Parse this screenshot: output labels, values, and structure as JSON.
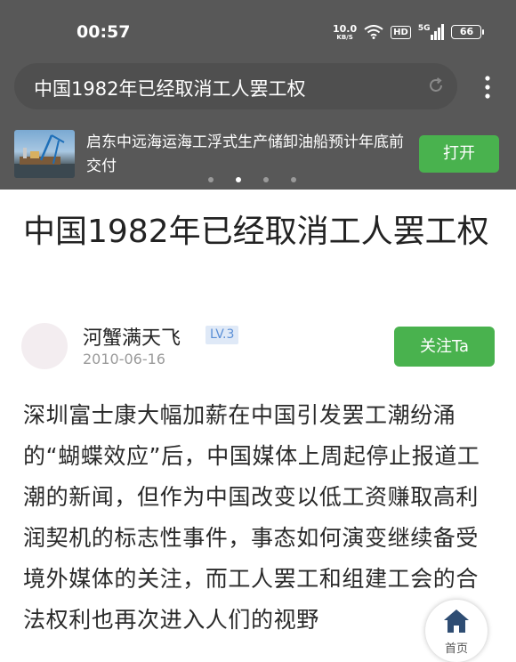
{
  "status_bar": {
    "time": "00:57",
    "net_speed_value": "10.0",
    "net_speed_unit": "KB/S",
    "hd": "HD",
    "signal": "5G",
    "battery": "66"
  },
  "search": {
    "query": "中国1982年已经取消工人罢工权",
    "refresh_icon": "refresh-icon",
    "more_icon": "more-vertical-icon"
  },
  "banner": {
    "text": "启东中远海运海工浮式生产储卸油船预计年底前交付",
    "button": "打开",
    "dots_total": 4,
    "active_dot": 1
  },
  "article": {
    "title": "中国1982年已经取消工人罢工权",
    "author": "河蟹满天飞",
    "level": "LV.3",
    "date": "2010-06-16",
    "follow_button": "关注Ta",
    "body": "深圳富士康大幅加薪在中国引发罢工潮纷涌的“蝴蝶效应”后，中国媒体上周起停止报道工潮的新闻，但作为中国改变以低工资赚取高利润契机的标志性事件，事态如何演变继续备受境外媒体的关注，而工人罢工和组建工会的合法权利也再次进入人们的视野"
  },
  "home_fab": {
    "label": "首页",
    "icon": "home-icon"
  },
  "colors": {
    "header_bg": "#585858",
    "accent_green": "#49b24e",
    "level_badge": "#5b8fd6"
  }
}
